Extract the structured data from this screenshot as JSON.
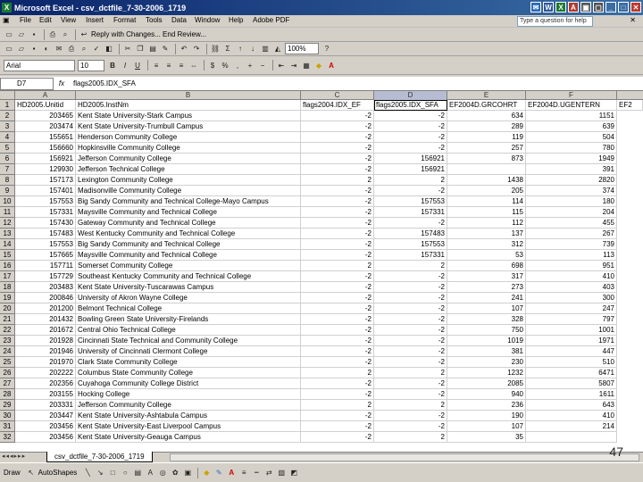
{
  "window": {
    "title": "Microsoft Excel - csv_dctfile_7-30-2006_1719"
  },
  "menu": [
    "File",
    "Edit",
    "View",
    "Insert",
    "Format",
    "Tools",
    "Data",
    "Window",
    "Help",
    "Adobe PDF"
  ],
  "help_placeholder": "Type a question for help",
  "review_text": "Reply with Changes... End Review...",
  "zoom": "100%",
  "font": {
    "name": "Arial",
    "size": "10"
  },
  "namebox": "D7",
  "fx": "fx",
  "formula": "flags2005.IDX_SFA",
  "columns": [
    "A",
    "B",
    "C",
    "D",
    "E",
    "F"
  ],
  "header_row": {
    "a": "HD2005.Unitid",
    "b": "HD2005.InstNm",
    "c": "flags2004.IDX_EF",
    "d": "flags2005.IDX_SFA",
    "e": "EF2004D.GRCOHRT",
    "f": "EF2004D.UGENTERN",
    "g": "EF2"
  },
  "rows": [
    {
      "n": "2",
      "a": "203465",
      "b": "Kent State University-Stark Campus",
      "c": "-2",
      "d": "-2",
      "e": "634",
      "f": "1151"
    },
    {
      "n": "3",
      "a": "203474",
      "b": "Kent State University-Trumbull Campus",
      "c": "-2",
      "d": "-2",
      "e": "289",
      "f": "639"
    },
    {
      "n": "4",
      "a": "155651",
      "b": "Henderson Community College",
      "c": "-2",
      "d": "-2",
      "e": "119",
      "f": "504"
    },
    {
      "n": "5",
      "a": "156660",
      "b": "Hopkinsville Community College",
      "c": "-2",
      "d": "-2",
      "e": "257",
      "f": "780"
    },
    {
      "n": "6",
      "a": "156921",
      "b": "Jefferson Community College",
      "c": "-2",
      "d": "156921",
      "e": "873",
      "f": "1949"
    },
    {
      "n": "7",
      "a": "129930",
      "b": "Jefferson Technical College",
      "c": "-2",
      "d": "156921",
      "e": "",
      "f": "391"
    },
    {
      "n": "8",
      "a": "157173",
      "b": "Lexington Community College",
      "c": "2",
      "d": "2",
      "e": "1438",
      "f": "2820"
    },
    {
      "n": "9",
      "a": "157401",
      "b": "Madisonville Community College",
      "c": "-2",
      "d": "-2",
      "e": "205",
      "f": "374"
    },
    {
      "n": "10",
      "a": "157553",
      "b": "Big Sandy Community and Technical College-Mayo Campus",
      "c": "-2",
      "d": "157553",
      "e": "114",
      "f": "180"
    },
    {
      "n": "11",
      "a": "157331",
      "b": "Maysville Community and Technical College",
      "c": "-2",
      "d": "157331",
      "e": "115",
      "f": "204"
    },
    {
      "n": "12",
      "a": "157430",
      "b": "Gateway Community and Technical College",
      "c": "-2",
      "d": "-2",
      "e": "112",
      "f": "455"
    },
    {
      "n": "13",
      "a": "157483",
      "b": "West Kentucky Community and Technical College",
      "c": "-2",
      "d": "157483",
      "e": "137",
      "f": "267"
    },
    {
      "n": "14",
      "a": "157553",
      "b": "Big Sandy Community and Technical College",
      "c": "-2",
      "d": "157553",
      "e": "312",
      "f": "739"
    },
    {
      "n": "15",
      "a": "157665",
      "b": "Maysville Community and Technical College",
      "c": "-2",
      "d": "157331",
      "e": "53",
      "f": "113"
    },
    {
      "n": "16",
      "a": "157711",
      "b": "Somerset Community College",
      "c": "2",
      "d": "2",
      "e": "698",
      "f": "951"
    },
    {
      "n": "17",
      "a": "157729",
      "b": "Southeast Kentucky Community and Technical College",
      "c": "-2",
      "d": "-2",
      "e": "317",
      "f": "410"
    },
    {
      "n": "18",
      "a": "203483",
      "b": "Kent State University-Tuscarawas Campus",
      "c": "-2",
      "d": "-2",
      "e": "273",
      "f": "403"
    },
    {
      "n": "19",
      "a": "200846",
      "b": "University of Akron Wayne College",
      "c": "-2",
      "d": "-2",
      "e": "241",
      "f": "300"
    },
    {
      "n": "20",
      "a": "201200",
      "b": "Belmont Technical College",
      "c": "-2",
      "d": "-2",
      "e": "107",
      "f": "247"
    },
    {
      "n": "21",
      "a": "201432",
      "b": "Bowling Green State University-Firelands",
      "c": "-2",
      "d": "-2",
      "e": "328",
      "f": "797"
    },
    {
      "n": "22",
      "a": "201672",
      "b": "Central Ohio Technical College",
      "c": "-2",
      "d": "-2",
      "e": "750",
      "f": "1001"
    },
    {
      "n": "23",
      "a": "201928",
      "b": "Cincinnati State Technical and Community College",
      "c": "-2",
      "d": "-2",
      "e": "1019",
      "f": "1971"
    },
    {
      "n": "24",
      "a": "201946",
      "b": "University of Cincinnati Clermont College",
      "c": "-2",
      "d": "-2",
      "e": "381",
      "f": "447"
    },
    {
      "n": "25",
      "a": "201970",
      "b": "Clark State Community College",
      "c": "-2",
      "d": "-2",
      "e": "230",
      "f": "510"
    },
    {
      "n": "26",
      "a": "202222",
      "b": "Columbus State Community College",
      "c": "2",
      "d": "2",
      "e": "1232",
      "f": "6471"
    },
    {
      "n": "27",
      "a": "202356",
      "b": "Cuyahoga Community College District",
      "c": "-2",
      "d": "-2",
      "e": "2085",
      "f": "5807"
    },
    {
      "n": "28",
      "a": "203155",
      "b": "Hocking College",
      "c": "-2",
      "d": "-2",
      "e": "940",
      "f": "1611"
    },
    {
      "n": "29",
      "a": "203331",
      "b": "Jefferson Community College",
      "c": "2",
      "d": "2",
      "e": "236",
      "f": "643"
    },
    {
      "n": "30",
      "a": "203447",
      "b": "Kent State University-Ashtabula Campus",
      "c": "-2",
      "d": "-2",
      "e": "190",
      "f": "410"
    },
    {
      "n": "31",
      "a": "203456",
      "b": "Kent State University-East Liverpool Campus",
      "c": "-2",
      "d": "-2",
      "e": "107",
      "f": "214"
    },
    {
      "n": "32",
      "a": "203456",
      "b": "Kent State University-Geauga Campus",
      "c": "-2",
      "d": "2",
      "e": "35",
      "f": ""
    }
  ],
  "sheet_tab": "csv_dctfile_7-30-2006_1719",
  "draw_label": "Draw",
  "autoshapes_label": "AutoShapes",
  "page_number": "47"
}
